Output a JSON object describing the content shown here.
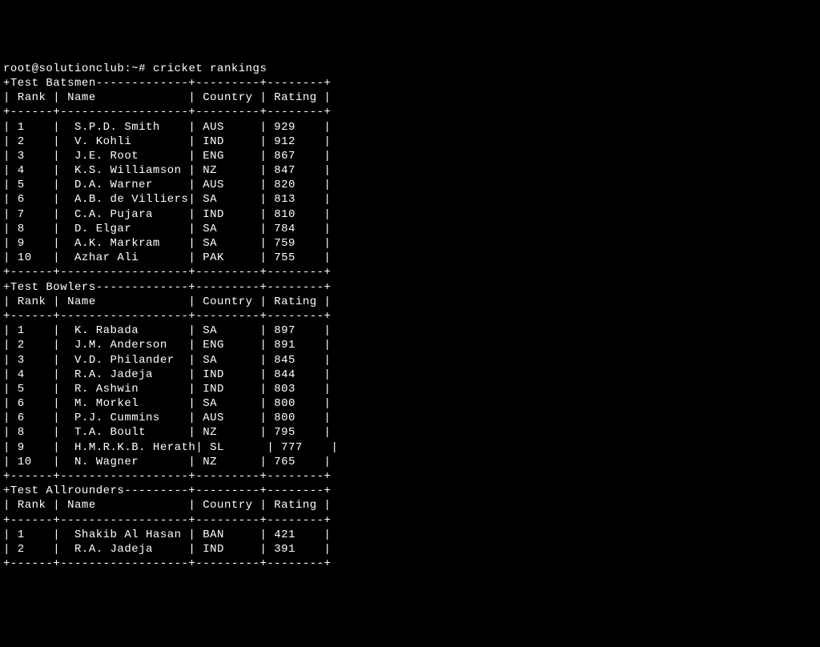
{
  "prompt": "root@solutionclub:~# ",
  "command": "cricket rankings",
  "tables": [
    {
      "title": "Test Batsmen",
      "columns": [
        "Rank",
        "Name",
        "Country",
        "Rating"
      ],
      "rows": [
        {
          "rank": "1",
          "name": "S.P.D. Smith",
          "country": "AUS",
          "rating": "929"
        },
        {
          "rank": "2",
          "name": "V. Kohli",
          "country": "IND",
          "rating": "912"
        },
        {
          "rank": "3",
          "name": "J.E. Root",
          "country": "ENG",
          "rating": "867"
        },
        {
          "rank": "4",
          "name": "K.S. Williamson",
          "country": "NZ",
          "rating": "847"
        },
        {
          "rank": "5",
          "name": "D.A. Warner",
          "country": "AUS",
          "rating": "820"
        },
        {
          "rank": "6",
          "name": "A.B. de Villiers",
          "country": "SA",
          "rating": "813"
        },
        {
          "rank": "7",
          "name": "C.A. Pujara",
          "country": "IND",
          "rating": "810"
        },
        {
          "rank": "8",
          "name": "D. Elgar",
          "country": "SA",
          "rating": "784"
        },
        {
          "rank": "9",
          "name": "A.K. Markram",
          "country": "SA",
          "rating": "759"
        },
        {
          "rank": "10",
          "name": "Azhar Ali",
          "country": "PAK",
          "rating": "755"
        }
      ]
    },
    {
      "title": "Test Bowlers",
      "columns": [
        "Rank",
        "Name",
        "Country",
        "Rating"
      ],
      "rows": [
        {
          "rank": "1",
          "name": "K. Rabada",
          "country": "SA",
          "rating": "897"
        },
        {
          "rank": "2",
          "name": "J.M. Anderson",
          "country": "ENG",
          "rating": "891"
        },
        {
          "rank": "3",
          "name": "V.D. Philander",
          "country": "SA",
          "rating": "845"
        },
        {
          "rank": "4",
          "name": "R.A. Jadeja",
          "country": "IND",
          "rating": "844"
        },
        {
          "rank": "5",
          "name": "R. Ashwin",
          "country": "IND",
          "rating": "803"
        },
        {
          "rank": "6",
          "name": "M. Morkel",
          "country": "SA",
          "rating": "800"
        },
        {
          "rank": "6",
          "name": "P.J. Cummins",
          "country": "AUS",
          "rating": "800"
        },
        {
          "rank": "8",
          "name": "T.A. Boult",
          "country": "NZ",
          "rating": "795"
        },
        {
          "rank": "9",
          "name": "H.M.R.K.B. Herath",
          "country": "SL",
          "rating": "777"
        },
        {
          "rank": "10",
          "name": "N. Wagner",
          "country": "NZ",
          "rating": "765"
        }
      ]
    },
    {
      "title": "Test Allrounders",
      "columns": [
        "Rank",
        "Name",
        "Country",
        "Rating"
      ],
      "rows": [
        {
          "rank": "1",
          "name": "Shakib Al Hasan",
          "country": "BAN",
          "rating": "421"
        },
        {
          "rank": "2",
          "name": "R.A. Jadeja",
          "country": "IND",
          "rating": "391"
        }
      ]
    }
  ],
  "widths": {
    "rank": 6,
    "name": 18,
    "country": 9,
    "rating": 8
  }
}
